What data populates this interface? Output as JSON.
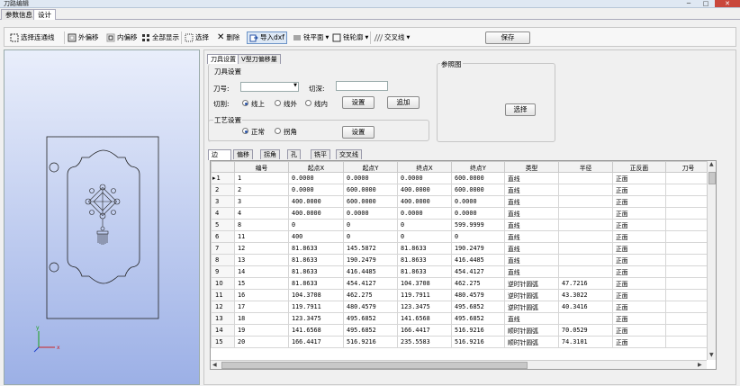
{
  "window": {
    "title": "刀路编辑",
    "minimize": "─",
    "maximize": "□",
    "close": "✕"
  },
  "tabs": [
    {
      "label": "参数信息"
    },
    {
      "label": "设计"
    }
  ],
  "toolbar": {
    "select_connected": "选择连通线",
    "outer_offset": "外偏移",
    "inner_offset": "内偏移",
    "show_all": "全部显示",
    "select": "选择",
    "delete": "删除",
    "import_dxf": "导入dxf",
    "mill_plane": "铣平面",
    "mill_contour": "铣轮廓",
    "cross_line": "交叉线",
    "save": "保存"
  },
  "axes": {
    "x": "x",
    "y": "y"
  },
  "panel": {
    "subtabs": [
      {
        "label": "刀具设置"
      },
      {
        "label": "V型刀偏移量"
      }
    ],
    "tool_group": "刀具设置",
    "tool_no_label": "刀号:",
    "tool_no_value": "",
    "depth_label": "切深:",
    "depth_value": "",
    "cut_label": "切割:",
    "cut_options": [
      "线上",
      "线外",
      "线内"
    ],
    "cut_selected": "线上",
    "settings_btn": "设置",
    "add_btn": "追加",
    "process_group": "工艺设置",
    "process_options": [
      "正常",
      "拐角"
    ],
    "process_selected": "正常",
    "process_settings_btn": "设置",
    "ref_group": "参照图",
    "ref_select_btn": "选择"
  },
  "grid": {
    "tabs": [
      "边",
      "偏移",
      "拐角",
      "孔",
      "铣平",
      "交叉线"
    ],
    "headers": [
      "",
      "编号",
      "起点X",
      "起点Y",
      "终点X",
      "终点Y",
      "类型",
      "半径",
      "正反面",
      "刀号"
    ],
    "rows": [
      {
        "row": "1",
        "id": "1",
        "sx": "0.0000",
        "sy": "0.0000",
        "ex": "0.0000",
        "ey": "600.0000",
        "type": "直线",
        "r": "",
        "face": "正面",
        "tool": "",
        "current": true
      },
      {
        "row": "2",
        "id": "2",
        "sx": "0.0000",
        "sy": "600.0000",
        "ex": "400.0000",
        "ey": "600.0000",
        "type": "直线",
        "r": "",
        "face": "正面",
        "tool": ""
      },
      {
        "row": "3",
        "id": "3",
        "sx": "400.0000",
        "sy": "600.0000",
        "ex": "400.0000",
        "ey": "0.0000",
        "type": "直线",
        "r": "",
        "face": "正面",
        "tool": ""
      },
      {
        "row": "4",
        "id": "4",
        "sx": "400.0000",
        "sy": "0.0000",
        "ex": "0.0000",
        "ey": "0.0000",
        "type": "直线",
        "r": "",
        "face": "正面",
        "tool": ""
      },
      {
        "row": "5",
        "id": "8",
        "sx": "0",
        "sy": "0",
        "ex": "0",
        "ey": "599.9999",
        "type": "直线",
        "r": "",
        "face": "正面",
        "tool": ""
      },
      {
        "row": "6",
        "id": "11",
        "sx": "400",
        "sy": "0",
        "ex": "0",
        "ey": "0",
        "type": "直线",
        "r": "",
        "face": "正面",
        "tool": ""
      },
      {
        "row": "7",
        "id": "12",
        "sx": "81.8633",
        "sy": "145.5872",
        "ex": "81.8633",
        "ey": "190.2479",
        "type": "直线",
        "r": "",
        "face": "正面",
        "tool": ""
      },
      {
        "row": "8",
        "id": "13",
        "sx": "81.8633",
        "sy": "190.2479",
        "ex": "81.8633",
        "ey": "416.4485",
        "type": "直线",
        "r": "",
        "face": "正面",
        "tool": ""
      },
      {
        "row": "9",
        "id": "14",
        "sx": "81.8633",
        "sy": "416.4485",
        "ex": "81.8633",
        "ey": "454.4127",
        "type": "直线",
        "r": "",
        "face": "正面",
        "tool": ""
      },
      {
        "row": "10",
        "id": "15",
        "sx": "81.8633",
        "sy": "454.4127",
        "ex": "104.3708",
        "ey": "462.275",
        "type": "逆时针圆弧",
        "r": "47.7216",
        "face": "正面",
        "tool": ""
      },
      {
        "row": "11",
        "id": "16",
        "sx": "104.3708",
        "sy": "462.275",
        "ex": "119.7911",
        "ey": "480.4579",
        "type": "逆时针圆弧",
        "r": "43.3022",
        "face": "正面",
        "tool": ""
      },
      {
        "row": "12",
        "id": "17",
        "sx": "119.7911",
        "sy": "480.4579",
        "ex": "123.3475",
        "ey": "495.6852",
        "type": "逆时针圆弧",
        "r": "40.3416",
        "face": "正面",
        "tool": ""
      },
      {
        "row": "13",
        "id": "18",
        "sx": "123.3475",
        "sy": "495.6852",
        "ex": "141.6568",
        "ey": "495.6852",
        "type": "直线",
        "r": "",
        "face": "正面",
        "tool": ""
      },
      {
        "row": "14",
        "id": "19",
        "sx": "141.6568",
        "sy": "495.6852",
        "ex": "166.4417",
        "ey": "516.9216",
        "type": "顺时针圆弧",
        "r": "70.0529",
        "face": "正面",
        "tool": ""
      },
      {
        "row": "15",
        "id": "20",
        "sx": "166.4417",
        "sy": "516.9216",
        "ex": "235.5583",
        "ey": "516.9216",
        "type": "顺时针圆弧",
        "r": "74.3101",
        "face": "正面",
        "tool": ""
      }
    ]
  }
}
